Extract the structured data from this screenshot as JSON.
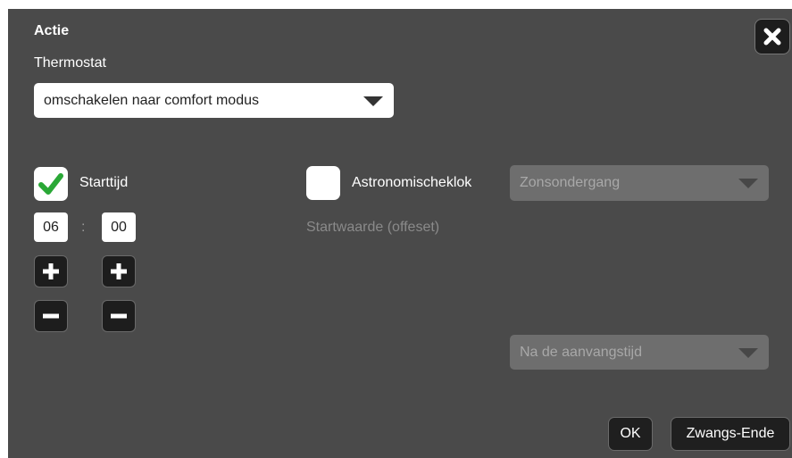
{
  "dialog": {
    "title": "Actie",
    "subtitle": "Thermostat",
    "action_select": {
      "value": "omschakelen naar comfort modus"
    },
    "start_time": {
      "checkbox_checked": true,
      "label": "Starttijd",
      "hours": "06",
      "separator": ":",
      "minutes": "00"
    },
    "astro": {
      "checkbox_checked": false,
      "label": "Astronomischeklok",
      "event_select": {
        "value": "Zonsondergang"
      },
      "offset_label": "Startwaarde (offeset)",
      "relation_select": {
        "value": "Na de aanvangstijd"
      }
    },
    "buttons": {
      "ok_label": "OK",
      "force_end_label": "Zwangs-Ende"
    }
  },
  "icons": {
    "close": "close-icon",
    "check": "check-icon",
    "plus": "plus-icon",
    "minus": "minus-icon",
    "dropdown": "chevron-down-icon"
  },
  "colors": {
    "dialog_bg": "#4a4a4a",
    "check_green": "#2aa836",
    "button_bg": "#1d1d1d"
  }
}
